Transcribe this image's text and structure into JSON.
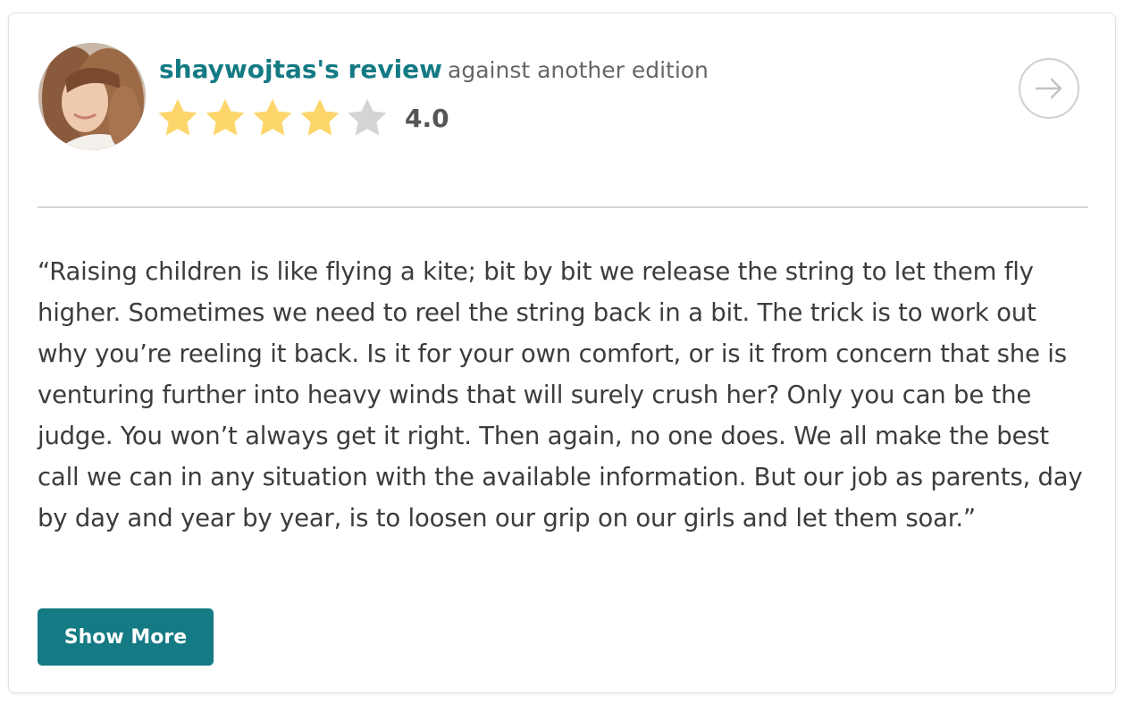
{
  "review": {
    "reviewer_name": "shaywojtas's review",
    "edition_note": "against another edition",
    "rating_value": "4.0",
    "rating_stars": 4,
    "rating_max": 5,
    "quote": "“Raising children is like flying a kite; bit by bit we release the string to let them fly higher. Sometimes we need to reel the string back in a bit. The trick is to work out why you’re reeling it back. Is it for your own comfort, or is it from concern that she is venturing further into heavy winds that will surely crush her? Only you can be the judge. You won’t always get it right. Then again, no one does. We all make the best call we can in any situation with the available information. But our job as parents, day by day and year by year, is to loosen our grip on our girls and let them soar.”",
    "show_more_label": "Show More"
  },
  "icons": {
    "next": "arrow-right-icon",
    "star": "star-icon",
    "avatar": "user-avatar"
  },
  "colors": {
    "brand": "#147a84",
    "star_filled": "#fdd66b",
    "star_empty": "#d4d4d4",
    "text": "#3c3c3c"
  }
}
